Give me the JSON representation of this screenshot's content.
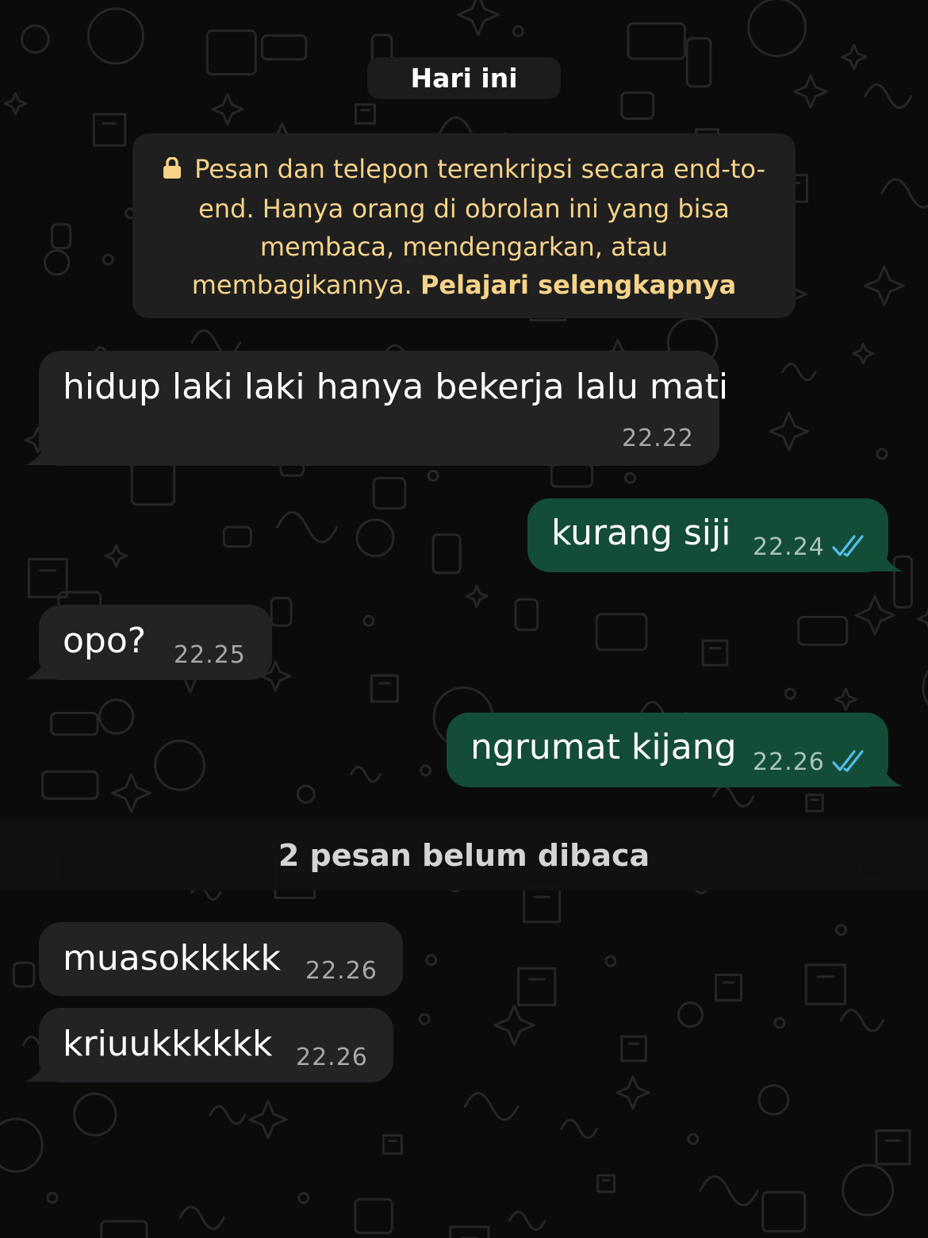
{
  "date_label": "Hari ini",
  "encryption_notice": {
    "text": "Pesan dan telepon terenkripsi secara end-to-end. Hanya orang di obrolan ini yang bisa membaca, mendengarkan, atau membagikannya.",
    "link_label": "Pelajari selengkapnya",
    "icon": "lock-icon"
  },
  "messages": [
    {
      "direction": "incoming",
      "text": "hidup laki laki hanya bekerja lalu mati",
      "time": "22.22"
    },
    {
      "direction": "outgoing",
      "text": "kurang siji",
      "time": "22.24",
      "status": "read",
      "status_icon": "double-check-icon"
    },
    {
      "direction": "incoming",
      "text": "opo?",
      "time": "22.25"
    },
    {
      "direction": "outgoing",
      "text": "ngrumat kijang",
      "time": "22.26",
      "status": "read",
      "status_icon": "double-check-icon"
    },
    {
      "direction": "incoming",
      "text": "muasokkkkk",
      "time": "22.26"
    },
    {
      "direction": "incoming",
      "text": "kriuukkkkkk",
      "time": "22.26"
    }
  ],
  "unread_divider": "2 pesan belum dibaca",
  "colors": {
    "background": "#0b0b0b",
    "incoming_bubble": "#222325",
    "outgoing_bubble": "#144d37",
    "notice_text": "#f6d389",
    "read_tick": "#53bdeb"
  }
}
